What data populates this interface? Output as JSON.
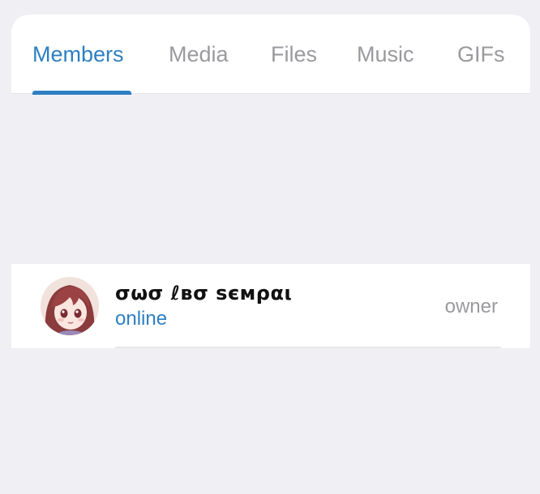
{
  "tabs": [
    {
      "label": "Members",
      "active": true
    },
    {
      "label": "Media",
      "active": false
    },
    {
      "label": "Files",
      "active": false
    },
    {
      "label": "Music",
      "active": false
    },
    {
      "label": "GIFs",
      "active": false
    }
  ],
  "members": [
    {
      "name": "σωσ ℓвσ ѕємραι",
      "status": "online",
      "role": "owner",
      "avatar": "anime-girl-avatar"
    }
  ],
  "colors": {
    "accent": "#2d7fc2",
    "background": "#efeff4",
    "inactive_text": "#9a9a9e"
  }
}
